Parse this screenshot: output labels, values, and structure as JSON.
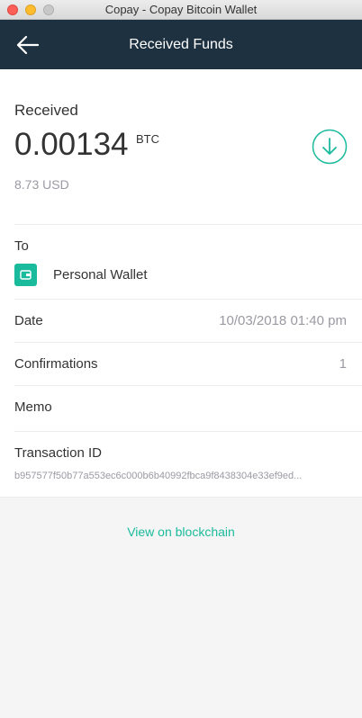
{
  "window": {
    "title": "Copay - Copay Bitcoin Wallet"
  },
  "nav": {
    "title": "Received Funds",
    "back_icon": "arrow-left-icon"
  },
  "summary": {
    "label": "Received",
    "amount": "0.00134",
    "unit": "BTC",
    "fiat": "8.73 USD",
    "icon": "arrow-down-circle-icon",
    "accent_color": "#1abb9c"
  },
  "to": {
    "label": "To",
    "wallet_name": "Personal Wallet",
    "wallet_icon": "wallet-icon"
  },
  "date": {
    "label": "Date",
    "value": "10/03/2018 01:40 pm"
  },
  "confirmations": {
    "label": "Confirmations",
    "value": "1"
  },
  "memo": {
    "label": "Memo"
  },
  "transaction": {
    "label": "Transaction ID",
    "id": "b957577f50b77a553ec6c000b6b40992fbca9f8438304e33ef9ed..."
  },
  "actions": {
    "view_blockchain": "View on blockchain"
  },
  "colors": {
    "navbar": "#1e3140",
    "accent": "#1abb9c"
  }
}
